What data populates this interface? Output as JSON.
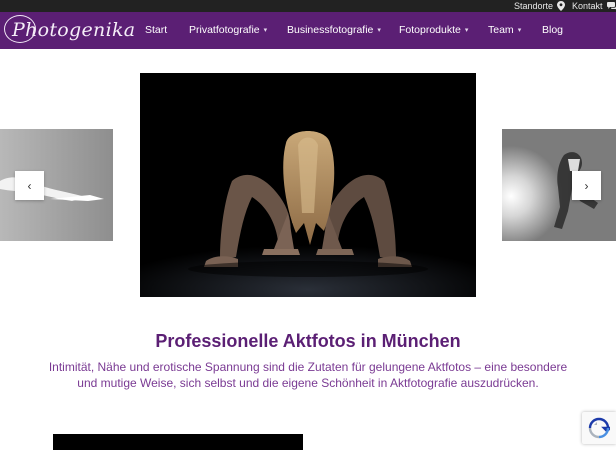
{
  "topbar": {
    "locations_label": "Standorte",
    "contact_label": "Kontakt"
  },
  "logo": {
    "text": "Photogenika"
  },
  "nav": {
    "items": [
      {
        "label": "Start",
        "has_submenu": false
      },
      {
        "label": "Privatfotografie",
        "has_submenu": true
      },
      {
        "label": "Businessfotografie",
        "has_submenu": true
      },
      {
        "label": "Fotoprodukte",
        "has_submenu": true
      },
      {
        "label": "Team",
        "has_submenu": true
      },
      {
        "label": "Blog",
        "has_submenu": false
      }
    ]
  },
  "slider": {
    "prev_icon": "chevron-left-icon",
    "next_icon": "chevron-right-icon",
    "prev_glyph": "‹",
    "next_glyph": "›"
  },
  "content": {
    "headline": "Professionelle Aktfotos in München",
    "subline": "Intimität, Nähe und erotische Spannung sind die Zutaten für gelungene Aktfotos – eine besondere und mutige Weise, sich selbst und die eigene Schönheit in Aktfotografie auszudrücken."
  },
  "colors": {
    "brand_purple": "#5b1f74",
    "topbar": "#222222",
    "headline": "#5b1f74",
    "subline": "#7a3a93"
  }
}
